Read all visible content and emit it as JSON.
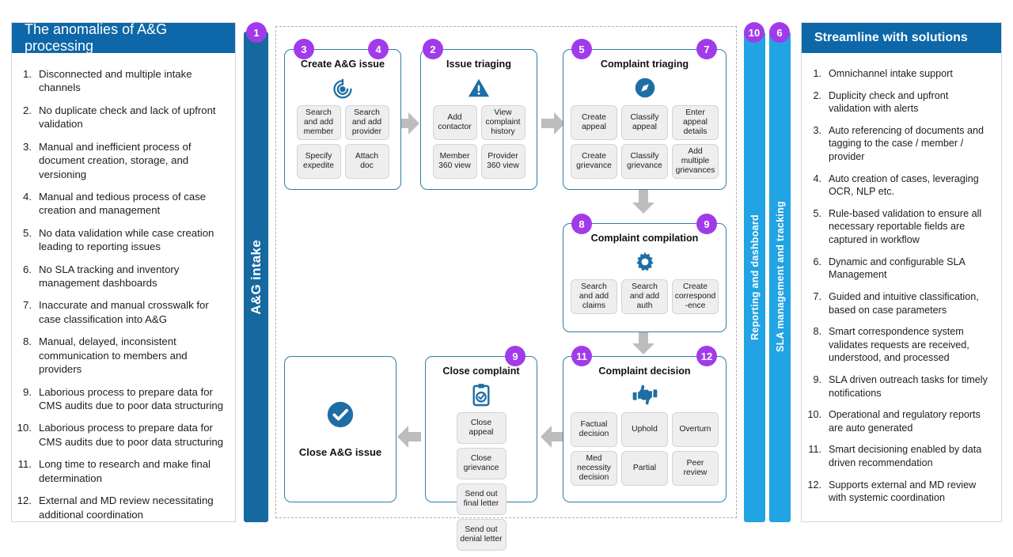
{
  "left_panel": {
    "title": "The anomalies of A&G processing",
    "items": [
      {
        "num": "1.",
        "text": "Disconnected and multiple intake channels"
      },
      {
        "num": "2.",
        "text": "No duplicate check and lack of upfront validation"
      },
      {
        "num": "3.",
        "text": "Manual and inefficient process of document creation, storage, and versioning"
      },
      {
        "num": "4.",
        "text": "Manual and tedious process of case creation and management"
      },
      {
        "num": "5.",
        "text": "No data validation while case creation leading to reporting issues"
      },
      {
        "num": "6.",
        "text": "No SLA tracking and inventory management dashboards"
      },
      {
        "num": "7.",
        "text": "Inaccurate and manual crosswalk for case classification into A&G"
      },
      {
        "num": "8.",
        "text": "Manual, delayed, inconsistent communication to members and providers"
      },
      {
        "num": "9.",
        "text": "Laborious process to prepare data for CMS audits due to poor data structuring"
      },
      {
        "num": "10.",
        "text": "Laborious process to prepare data for CMS audits due to poor data structuring"
      },
      {
        "num": "11.",
        "text": "Long time to research and make final determination"
      },
      {
        "num": "12.",
        "text": "External and MD review necessitating additional coordination"
      }
    ]
  },
  "right_panel": {
    "title": "Streamline with solutions",
    "items": [
      {
        "num": "1.",
        "text": "Omnichannel intake support"
      },
      {
        "num": "2.",
        "text": "Duplicity check and upfront validation with alerts"
      },
      {
        "num": "3.",
        "text": "Auto referencing of documents and tagging to the case / member / provider"
      },
      {
        "num": "4.",
        "text": "Auto creation of cases, leveraging OCR, NLP etc."
      },
      {
        "num": "5.",
        "text": "Rule-based validation to ensure all necessary reportable fields are captured in workflow"
      },
      {
        "num": "6.",
        "text": "Dynamic and configurable SLA Management"
      },
      {
        "num": "7.",
        "text": "Guided and intuitive classification, based on case parameters"
      },
      {
        "num": "8.",
        "text": "Smart correspondence system validates requests are received, understood, and processed"
      },
      {
        "num": "9.",
        "text": "SLA driven outreach tasks for timely notifications"
      },
      {
        "num": "10.",
        "text": "Operational and regulatory reports are auto generated"
      },
      {
        "num": "11.",
        "text": "Smart decisioning enabled by data driven recommendation"
      },
      {
        "num": "12.",
        "text": "Supports external and MD review with systemic coordination"
      }
    ]
  },
  "bars": {
    "intake": {
      "label": "A&G intake",
      "badge": "1",
      "color": "#15699f"
    },
    "reporting": {
      "label": "Reporting and dashboard",
      "badge": "10",
      "color": "#22a3e3"
    },
    "sla": {
      "label": "SLA management and tracking",
      "badge": "6",
      "color": "#22a3e3"
    }
  },
  "flow": {
    "create_issue": {
      "title": "Create A&G issue",
      "icon": "target-icon",
      "badges": [
        "3",
        "4"
      ],
      "chips": [
        "Search and add member",
        "Search and add provider",
        "Specify expedite",
        "Attach doc"
      ]
    },
    "issue_triaging": {
      "title": "Issue triaging",
      "icon": "warning-icon",
      "badges": [
        "2"
      ],
      "chips": [
        "Add contactor",
        "View complaint history",
        "Member 360 view",
        "Provider 360 view"
      ]
    },
    "complaint_triaging": {
      "title": "Complaint triaging",
      "icon": "compass-icon",
      "badges": [
        "5",
        "7"
      ],
      "chips": [
        "Create appeal",
        "Classify appeal",
        "Enter appeal details",
        "Create grievance",
        "Classify grievance",
        "Add multiple grievances"
      ]
    },
    "complaint_compilation": {
      "title": "Complaint compilation",
      "icon": "gear-icon",
      "badges": [
        "8",
        "9"
      ],
      "chips": [
        "Search and add claims",
        "Search and add auth",
        "Create correspond -ence"
      ]
    },
    "complaint_decision": {
      "title": "Complaint decision",
      "icon": "thumbs-icon",
      "badges": [
        "11",
        "12"
      ],
      "chips": [
        "Factual decision",
        "Uphold",
        "Overturn",
        "Med necessity decision",
        "Partial",
        "Peer review"
      ]
    },
    "close_complaint": {
      "title": "Close complaint",
      "icon": "clipboard-check-icon",
      "badges": [
        "9"
      ],
      "chips": [
        "Close appeal",
        "Close grievance",
        "Send out final letter",
        "Send out denial letter"
      ]
    },
    "close_issue": {
      "title": "Close A&G issue",
      "icon": "check-circle-icon",
      "badges": []
    }
  },
  "colors": {
    "header_blue": "#0d67a8",
    "badge_purple": "#a13bea",
    "icon_blue": "#1e6ea5",
    "chip_grey": "#eeeeee",
    "arrow_grey": "#bdbdbd"
  }
}
